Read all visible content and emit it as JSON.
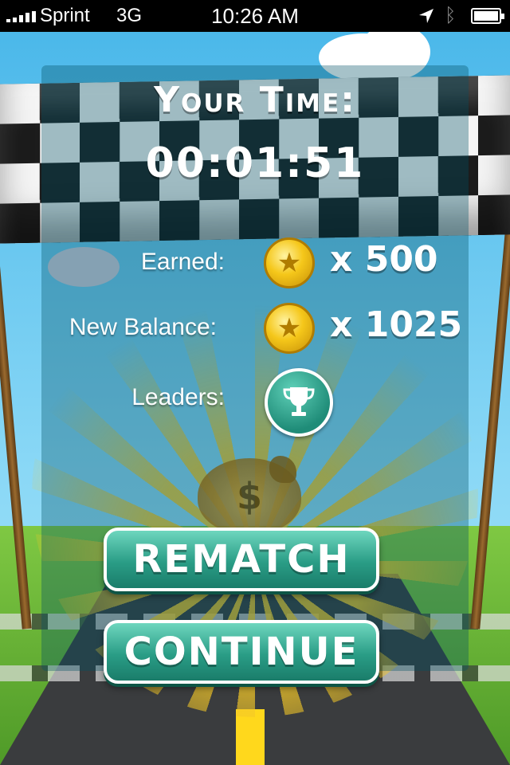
{
  "status_bar": {
    "carrier": "Sprint",
    "network": "3G",
    "time": "10:26 AM"
  },
  "results": {
    "title": "Your Time:",
    "time": "00:01:51",
    "earned_label": "Earned:",
    "earned_amount": "x 500",
    "balance_label": "New Balance:",
    "balance_amount": "x 1025",
    "leaders_label": "Leaders:"
  },
  "buttons": {
    "rematch": "REMATCH",
    "continue": "CONTINUE"
  },
  "icons": {
    "coin": "star-coin-icon",
    "trophy": "trophy-icon",
    "money_bag": "money-bag-icon"
  },
  "colors": {
    "button_teal": "#2a9d86",
    "coin_gold": "#f5c71a"
  }
}
